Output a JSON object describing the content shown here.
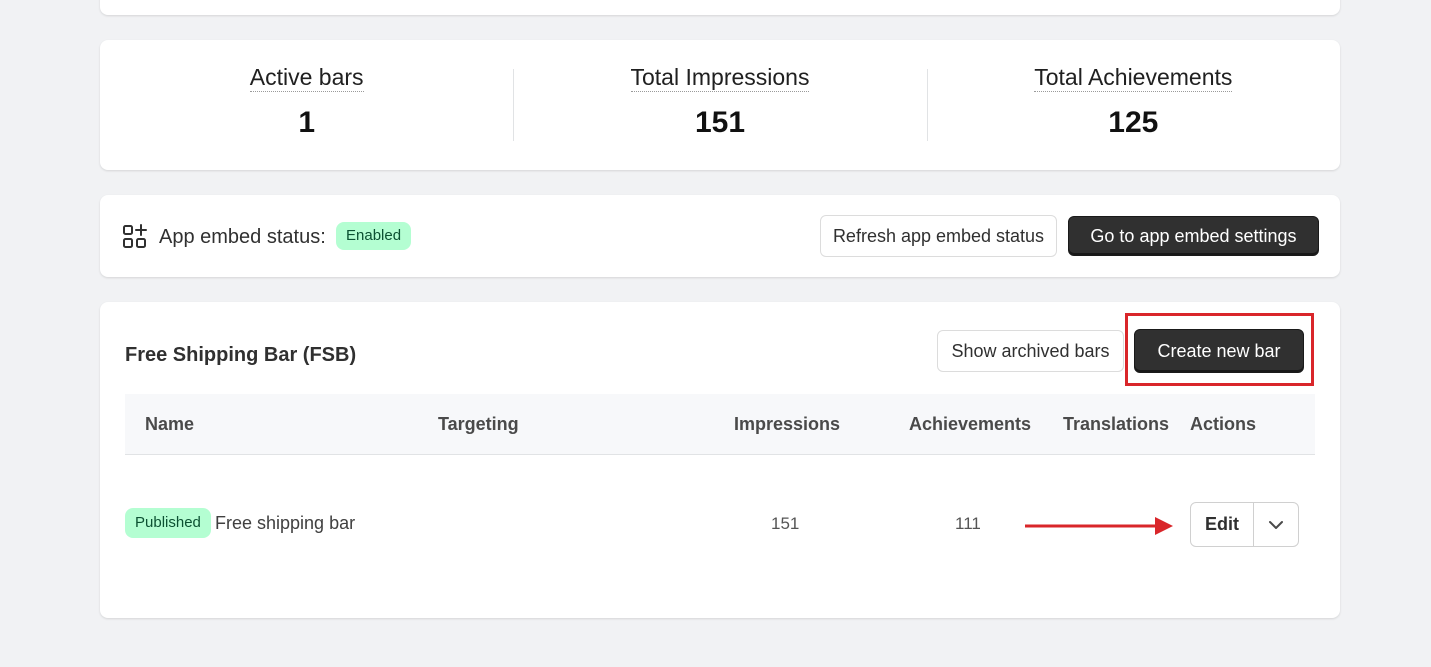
{
  "stats": [
    {
      "label": "Active bars",
      "value": "1"
    },
    {
      "label": "Total Impressions",
      "value": "151"
    },
    {
      "label": "Total Achievements",
      "value": "125"
    }
  ],
  "embed": {
    "label": "App embed status:",
    "status": "Enabled",
    "refresh_label": "Refresh app embed status",
    "goto_label": "Go to app embed settings",
    "icon": "apps-add-icon"
  },
  "fsb": {
    "title": "Free Shipping Bar (FSB)",
    "archived_label": "Show archived bars",
    "create_label": "Create new bar",
    "columns": [
      "Name",
      "Targeting",
      "Impressions",
      "Achievements",
      "Translations",
      "Actions"
    ],
    "rows": [
      {
        "status": "Published",
        "name": "Free shipping bar",
        "targeting": "",
        "impressions": "151",
        "achievements": "111",
        "translations": "",
        "edit_label": "Edit"
      }
    ]
  },
  "colors": {
    "success_badge_bg": "#b4fed2",
    "success_badge_text": "#0c5132",
    "primary_button": "#303030",
    "annotation_red": "#d9262a"
  }
}
